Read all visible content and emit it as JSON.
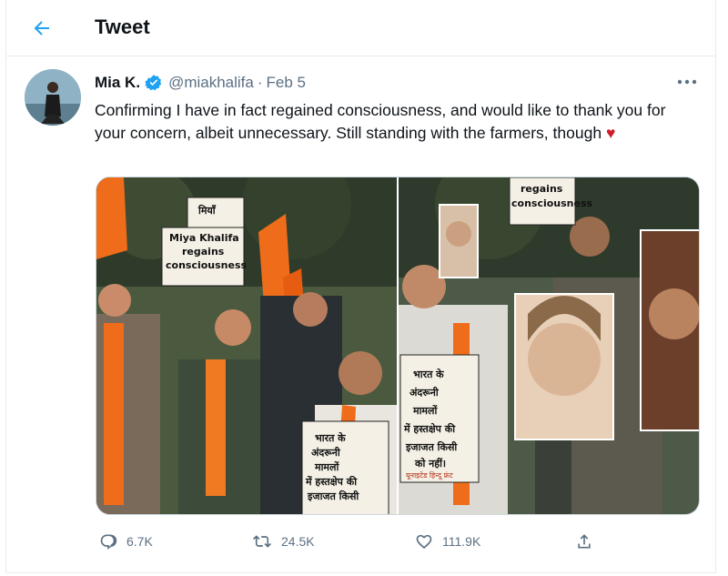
{
  "header": {
    "title": "Tweet"
  },
  "author": {
    "name": "Mia K.",
    "handle": "@miakhalifa",
    "separator": "·",
    "date": "Feb 5"
  },
  "tweet": {
    "text": "Confirming I have in fact regained consciousness, and would like to thank you for your concern, albeit unnecessary. Still standing with the farmers, though",
    "emoji": "♥"
  },
  "media": {
    "left_signs": [
      "मियाँ",
      "Miya Khalifa",
      "regains",
      "consciousness",
      "भारत के",
      "अंदरूनी",
      "मामलों",
      "में हस्तक्षेप की",
      "इजाजत किसी"
    ],
    "right_signs": [
      "regains",
      "consciousness",
      "भारत के",
      "अंदरूनी",
      "मामलों",
      "में हस्तक्षेप की",
      "इजाजत किसी",
      "को नहीं।",
      "यूनाइटेड हिन्दू फ्रंट"
    ]
  },
  "actions": {
    "reply_count": "6.7K",
    "retweet_count": "24.5K",
    "like_count": "111.9K"
  },
  "colors": {
    "accent": "#1da1f2",
    "secondary_text": "#5b7083",
    "heart": "#d01c2a",
    "saffron": "#ef6c1a"
  }
}
